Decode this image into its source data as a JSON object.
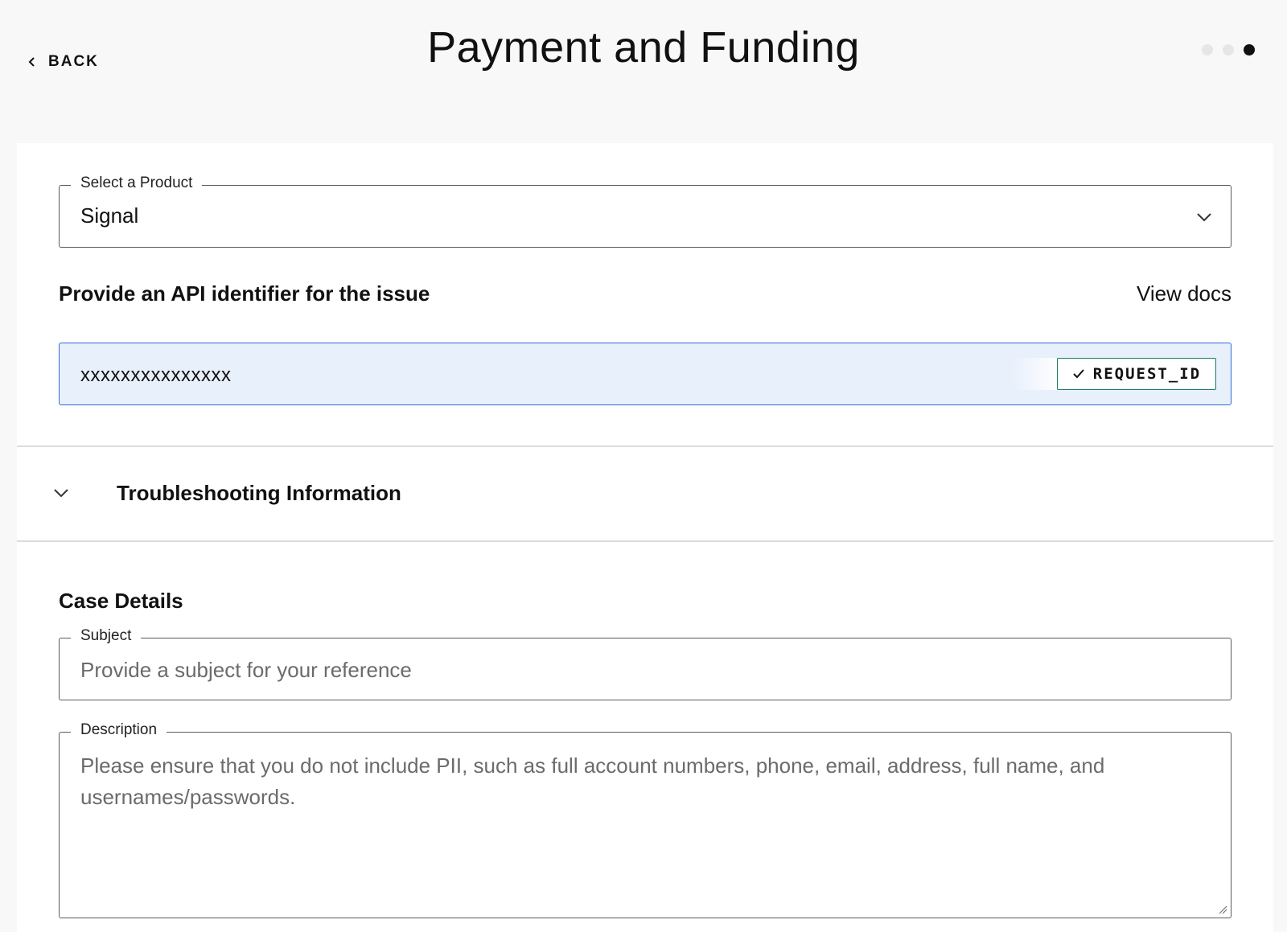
{
  "header": {
    "back_label": "BACK",
    "title": "Payment and Funding",
    "steps": [
      {
        "active": false
      },
      {
        "active": false
      },
      {
        "active": true
      }
    ]
  },
  "product": {
    "legend": "Select a Product",
    "selected": "Signal"
  },
  "api": {
    "label": "Provide an API identifier for the issue",
    "view_docs": "View docs",
    "value": "xxxxxxxxxxxxxxx",
    "badge": "REQUEST_ID",
    "badge_color": "#1c7a62",
    "focus_color": "#2f6bd6"
  },
  "troubleshooting": {
    "label": "Troubleshooting Information"
  },
  "case_details": {
    "title": "Case Details",
    "subject": {
      "legend": "Subject",
      "placeholder": "Provide a subject for your reference"
    },
    "description": {
      "legend": "Description",
      "placeholder": "Please ensure that you do not include PII, such as full account numbers, phone, email, address, full name, and usernames/passwords."
    }
  },
  "icons": {
    "back": "chevron-left-icon",
    "select": "chevron-down-icon",
    "badge": "check-icon",
    "accordion": "chevron-down-icon"
  }
}
